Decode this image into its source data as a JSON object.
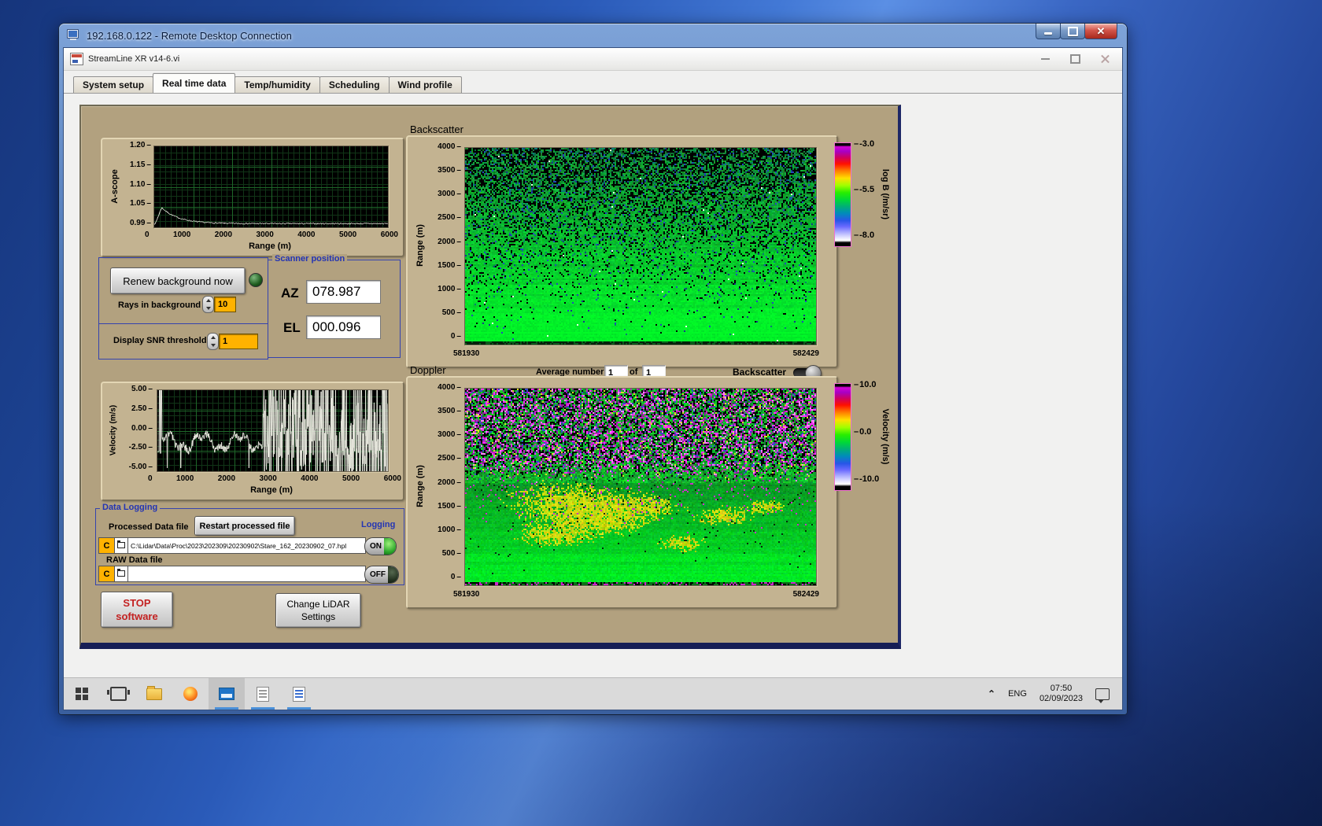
{
  "rdp_window": {
    "title": "192.168.0.122 - Remote Desktop Connection"
  },
  "app_window": {
    "title": "StreamLine XR v14-6.vi"
  },
  "tabs": {
    "items": [
      "System setup",
      "Real time data",
      "Temp/humidity",
      "Scheduling",
      "Wind profile"
    ],
    "active_index": 1
  },
  "ascope": {
    "ylabel": "A-scope",
    "xlabel": "Range (m)",
    "yticks": [
      "1.20",
      "1.15",
      "1.10",
      "1.05",
      "0.99"
    ],
    "xticks": [
      "0",
      "1000",
      "2000",
      "3000",
      "4000",
      "5000",
      "6000"
    ]
  },
  "background_controls": {
    "renew_button": "Renew background now",
    "rays_label": "Rays in background",
    "rays_value": "10",
    "snr_label": "Display SNR threshold",
    "snr_value": "1"
  },
  "scanner": {
    "title": "Scanner position",
    "az_label": "AZ",
    "az_value": "078.987",
    "el_label": "EL",
    "el_value": "000.096"
  },
  "backscatter": {
    "title": "Backscatter",
    "ylabel": "Range (m)",
    "yticks": [
      "4000",
      "3500",
      "3000",
      "2500",
      "2000",
      "1500",
      "1000",
      "500",
      "0"
    ],
    "x_left": "581930",
    "x_right": "582429",
    "colorbar_label": "log B (/m/sr)",
    "colorbar_ticks": [
      "-3.0",
      "-5.5",
      "-8.0"
    ]
  },
  "doppler": {
    "title": "Doppler",
    "avg_label": "Average number",
    "avg_value": "1",
    "of_label": "of",
    "of_count": "1",
    "toggle_label": "Backscatter",
    "ylabel": "Range (m)",
    "yticks": [
      "4000",
      "3500",
      "3000",
      "2500",
      "2000",
      "1500",
      "1000",
      "500",
      "0"
    ],
    "x_left": "581930",
    "x_right": "582429",
    "colorbar_label": "Velocity (m/s)",
    "colorbar_ticks": [
      "10.0",
      "0.0",
      "-10.0"
    ]
  },
  "velocity": {
    "ylabel": "Velocity (m/s)",
    "xlabel": "Range (m)",
    "yticks": [
      "5.00",
      "2.50",
      "0.00",
      "-2.50",
      "-5.00"
    ],
    "xticks": [
      "0",
      "1000",
      "2000",
      "3000",
      "4000",
      "5000",
      "6000"
    ]
  },
  "data_logging": {
    "title": "Data Logging",
    "processed_label": "Processed Data file",
    "restart_button": "Restart processed file",
    "logging_label": "Logging",
    "drive": "C",
    "processed_path": "C:\\Lidar\\Data\\Proc\\2023\\202309\\20230902\\Stare_162_20230902_07.hpl",
    "on_label": "ON",
    "raw_label": "RAW Data file",
    "raw_path": "",
    "off_label": "OFF"
  },
  "actions": {
    "stop_line1": "STOP",
    "stop_line2": "software",
    "change_line1": "Change LiDAR",
    "change_line2": "Settings"
  },
  "taskbar": {
    "language": "ENG",
    "time": "07:50",
    "date": "02/09/2023"
  },
  "colors": {
    "accent_blue": "#2334b4",
    "panel_tan": "#b2a17f",
    "amber": "#ffb200",
    "led_green": "#2fae32",
    "stop_red": "#c32222"
  }
}
